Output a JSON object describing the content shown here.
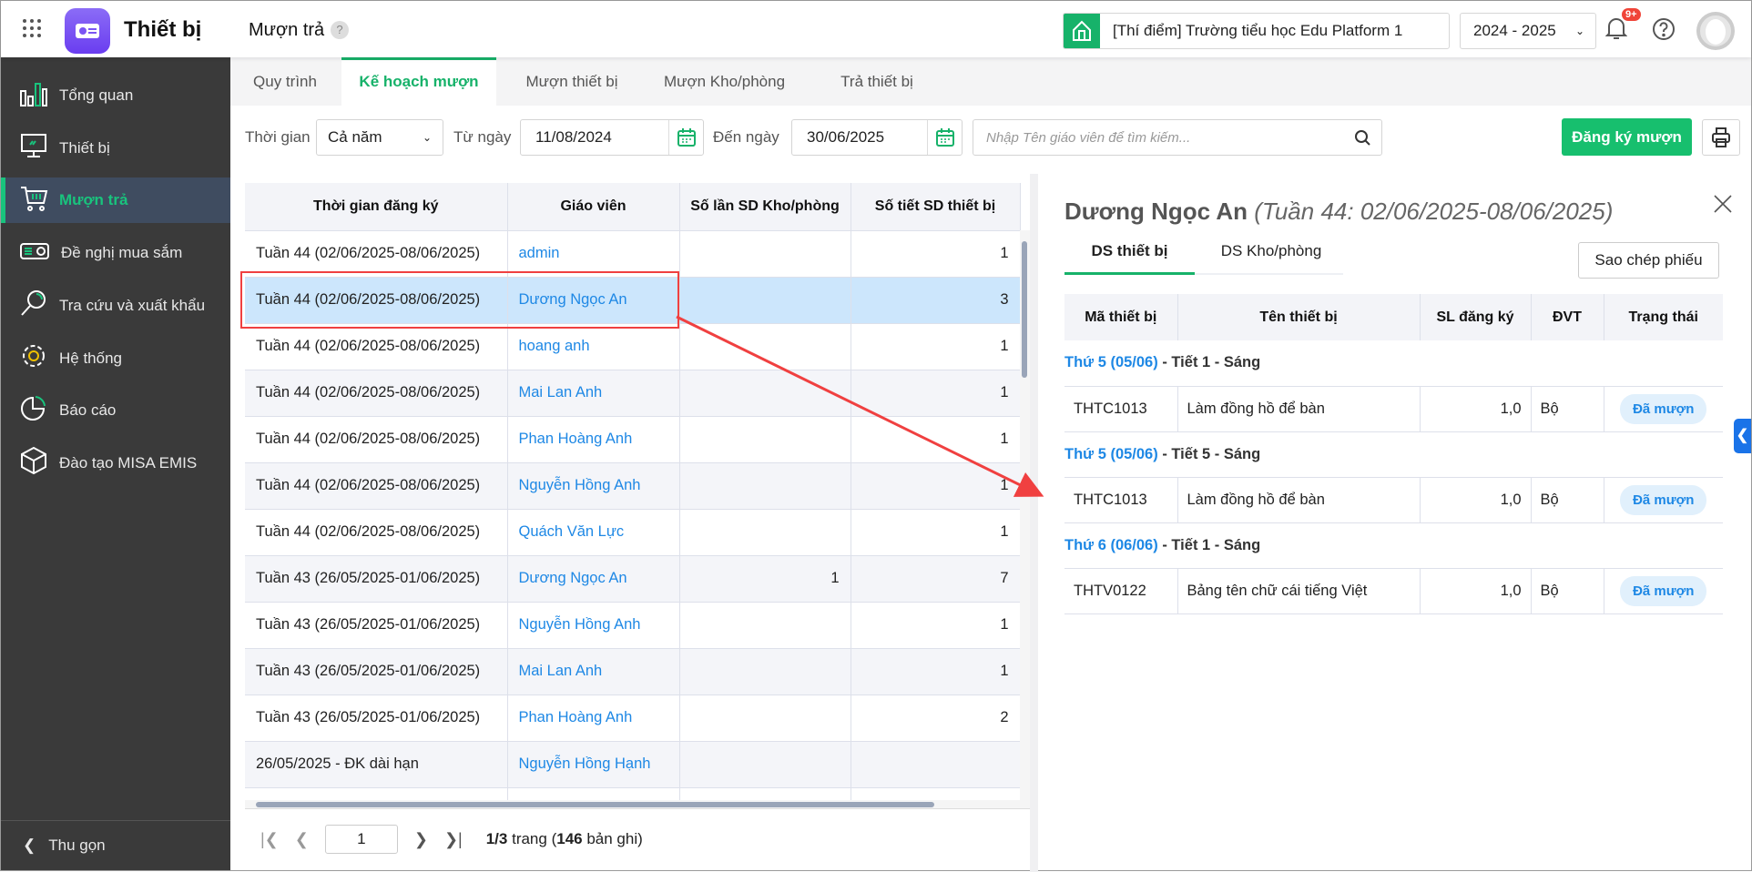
{
  "header": {
    "app_title": "Thiết bị",
    "page_title": "Mượn trả",
    "help_mark": "?",
    "school": "[Thí điểm] Trường tiểu học Edu Platform 1",
    "year": "2024 - 2025",
    "notif_badge": "9+"
  },
  "sidebar": {
    "items": [
      {
        "label": "Tổng quan",
        "icon": "bar-chart-icon"
      },
      {
        "label": "Thiết bị",
        "icon": "monitor-icon"
      },
      {
        "label": "Mượn trả",
        "icon": "cart-icon",
        "active": true
      },
      {
        "label": "Đề nghị mua sắm",
        "icon": "projector-icon"
      },
      {
        "label": "Tra cứu và xuất khẩu",
        "icon": "search-icon"
      },
      {
        "label": "Hệ thống",
        "icon": "gear-icon"
      },
      {
        "label": "Báo cáo",
        "icon": "pie-chart-icon"
      },
      {
        "label": "Đào tạo MISA EMIS",
        "icon": "cube-icon"
      }
    ],
    "collapse": "Thu gọn"
  },
  "tabs": [
    {
      "label": "Quy trình"
    },
    {
      "label": "Kế hoạch mượn",
      "active": true
    },
    {
      "label": "Mượn thiết bị"
    },
    {
      "label": "Mượn Kho/phòng"
    },
    {
      "label": "Trả thiết bị"
    }
  ],
  "filters": {
    "time_label": "Thời gian",
    "time_value": "Cả năm",
    "from_label": "Từ ngày",
    "from_value": "11/08/2024",
    "to_label": "Đến ngày",
    "to_value": "30/06/2025",
    "search_placeholder": "Nhập Tên giáo viên để tìm kiếm...",
    "register_button": "Đăng ký mượn"
  },
  "table": {
    "columns": [
      "Thời gian đăng ký",
      "Giáo viên",
      "Số lần SD Kho/phòng",
      "Số tiết SD thiết bị"
    ],
    "rows": [
      [
        "Tuần 44 (02/06/2025-08/06/2025)",
        "admin",
        "",
        "1"
      ],
      [
        "Tuần 44 (02/06/2025-08/06/2025)",
        "Dương Ngọc An",
        "",
        "3"
      ],
      [
        "Tuần 44 (02/06/2025-08/06/2025)",
        "hoang anh",
        "",
        "1"
      ],
      [
        "Tuần 44 (02/06/2025-08/06/2025)",
        "Mai Lan Anh",
        "",
        "1"
      ],
      [
        "Tuần 44 (02/06/2025-08/06/2025)",
        "Phan Hoàng Anh",
        "",
        "1"
      ],
      [
        "Tuần 44 (02/06/2025-08/06/2025)",
        "Nguyễn Hồng Anh",
        "",
        "1"
      ],
      [
        "Tuần 44 (02/06/2025-08/06/2025)",
        "Quách Văn Lực",
        "",
        "1"
      ],
      [
        "Tuần 43 (26/05/2025-01/06/2025)",
        "Dương Ngọc An",
        "1",
        "7"
      ],
      [
        "Tuần 43 (26/05/2025-01/06/2025)",
        "Nguyễn Hồng Anh",
        "",
        "1"
      ],
      [
        "Tuần 43 (26/05/2025-01/06/2025)",
        "Mai Lan Anh",
        "",
        "1"
      ],
      [
        "Tuần 43 (26/05/2025-01/06/2025)",
        "Phan Hoàng Anh",
        "",
        "2"
      ],
      [
        "26/05/2025 - ĐK dài hạn",
        "Nguyễn Hồng Hạnh",
        "",
        ""
      ],
      [
        "",
        "",
        "",
        ""
      ]
    ],
    "selected_index": 1
  },
  "pagination": {
    "page": "1",
    "page_info": "1/3",
    "page_word": "trang",
    "records": "146",
    "records_word": "bản ghi"
  },
  "detail": {
    "name": "Dương Ngọc An",
    "week": "(Tuần 44: 02/06/2025-08/06/2025)",
    "tabs": [
      "DS thiết bị",
      "DS Kho/phòng"
    ],
    "copy_button": "Sao chép phiếu",
    "columns": [
      "Mã thiết bị",
      "Tên thiết bị",
      "SL đăng ký",
      "ĐVT",
      "Trạng thái"
    ],
    "groups": [
      {
        "day": "Thứ 5 (05/06)",
        "rest": " - Tiết 1 - Sáng",
        "items": [
          [
            "THTC1013",
            "Làm đồng hồ để bàn",
            "1,0",
            "Bộ",
            "Đã mượn"
          ]
        ]
      },
      {
        "day": "Thứ 5 (05/06)",
        "rest": " - Tiết 5 - Sáng",
        "items": [
          [
            "THTC1013",
            "Làm đồng hồ để bàn",
            "1,0",
            "Bộ",
            "Đã mượn"
          ]
        ]
      },
      {
        "day": "Thứ 6 (06/06)",
        "rest": " - Tiết 1 - Sáng",
        "items": [
          [
            "THTV0122",
            "Bảng tên chữ cái tiếng Việt",
            "1,0",
            "Bộ",
            "Đã mượn"
          ]
        ]
      }
    ]
  },
  "colors": {
    "accent": "#17b26a",
    "link": "#1e88e5",
    "selected_row": "#cce6fc",
    "sidebar": "#3a3a3a",
    "annotation": "#f04040"
  }
}
